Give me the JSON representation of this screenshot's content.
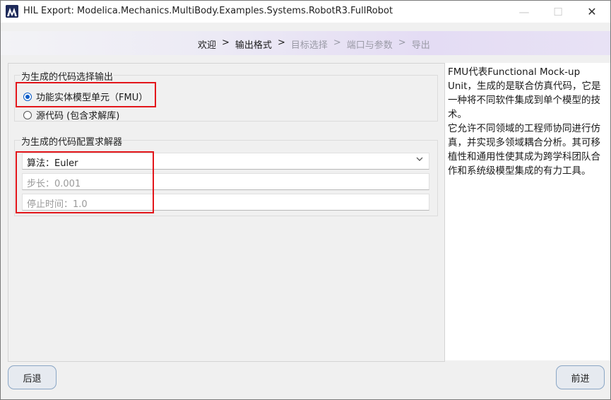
{
  "window": {
    "title": "HIL Export: Modelica.Mechanics.MultiBody.Examples.Systems.RobotR3.FullRobot",
    "min_glyph": "—",
    "max_glyph": "☐",
    "close_glyph": "✕"
  },
  "breadcrumb": {
    "steps": [
      {
        "label": "欢迎",
        "state": "done"
      },
      {
        "label": "输出格式",
        "state": "current"
      },
      {
        "label": "目标选择",
        "state": "pending"
      },
      {
        "label": "端口与参数",
        "state": "pending"
      },
      {
        "label": "导出",
        "state": "pending"
      }
    ],
    "separator": ">"
  },
  "output_group": {
    "title": "为生成的代码选择输出",
    "options": [
      {
        "label": "功能实体模型单元（FMU）",
        "selected": true
      },
      {
        "label": "源代码 (包含求解库)",
        "selected": false
      }
    ]
  },
  "solver_group": {
    "title": "为生成的代码配置求解器",
    "algorithm_value": "算法：Euler",
    "step_placeholder": "步长：0.001",
    "stop_time_placeholder": "停止时间：1.0"
  },
  "description": {
    "text": "FMU代表Functional Mock-up Unit，生成的是联合仿真代码，它是一种将不同软件集成到单个模型的技术。\n它允许不同领域的工程师协同进行仿真，并实现多领域耦合分析。其可移植性和通用性使其成为跨学科团队合作和系统级模型集成的有力工具。"
  },
  "buttons": {
    "back": "后退",
    "next": "前进"
  },
  "colors": {
    "highlight": "#e3161b",
    "accent": "#0a5cc7"
  },
  "icons": {
    "app": "matlab-like-app-icon",
    "dropdown": "chevron-down-icon"
  }
}
